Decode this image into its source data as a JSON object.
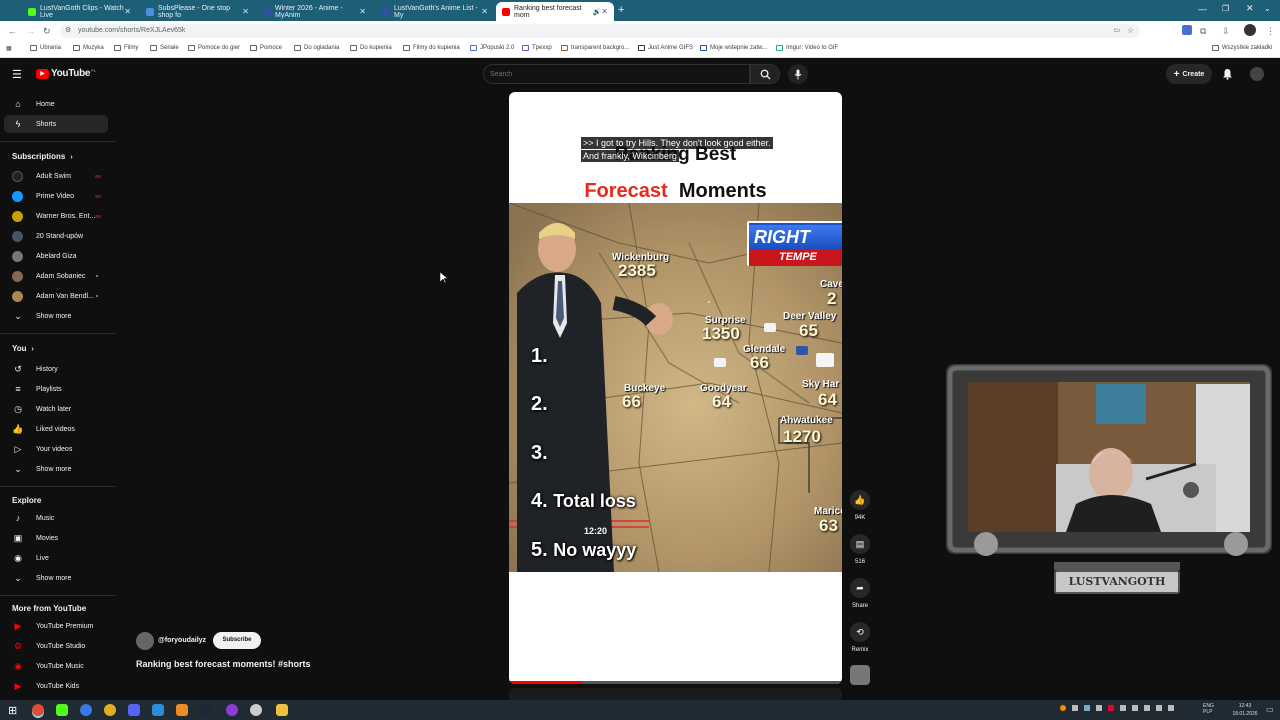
{
  "browser": {
    "tabs": [
      {
        "title": "LustVanGoth Clips - Watch Live",
        "color": "#53fc18"
      },
      {
        "title": "SubsPlease - One stop shop fo",
        "color": "#4a8fe0"
      },
      {
        "title": "Winter 2026 - Anime - MyAnim",
        "color": "#2e51a2"
      },
      {
        "title": "LustVanGoth's Anime List - My",
        "color": "#2e51a2"
      },
      {
        "title": "Ranking best forecast mom",
        "color": "#ff0000"
      }
    ],
    "new_tab": "+",
    "url": "youtube.com/shorts/ReXJLAev65k",
    "bookmarks": [
      "Ubrania",
      "Muzyka",
      "Filmy",
      "Seriale",
      "Pomoce do gier",
      "Pomoce",
      "Do ogladania",
      "Do kupienia",
      "Filmy do kupienia",
      "JPopuski 2.0",
      "Tpexxp",
      "transparent backgro...",
      "Just Anime GIFS",
      "Moje wstepnie zatw...",
      "Imgur: Video to GIF"
    ],
    "all_bookmarks": "Wszystkie zakładki"
  },
  "youtube": {
    "logo_text": "YouTube",
    "logo_country": "PL",
    "search_placeholder": "Search",
    "create_label": "Create",
    "nav": [
      {
        "label": "Home",
        "icon": "home-icon"
      },
      {
        "label": "Shorts",
        "icon": "shorts-icon"
      }
    ],
    "subscriptions_heading": "Subscriptions",
    "subscriptions": [
      {
        "name": "Adult Swim",
        "color": "#222222",
        "live": true
      },
      {
        "name": "Prime Video",
        "color": "#1a98ff",
        "live": true
      },
      {
        "name": "Warner Bros. Ent...",
        "color": "#c8a000",
        "live": true
      },
      {
        "name": "20 Stand-upów",
        "color": "#445566",
        "live": false
      },
      {
        "name": "Abelard Giza",
        "color": "#777777",
        "live": false
      },
      {
        "name": "Adam Sobaniec",
        "color": "#886655",
        "live": false
      },
      {
        "name": "Adam Van Bendl...",
        "color": "#aa8855",
        "live": false
      }
    ],
    "show_more": "Show more",
    "you_heading": "You",
    "you_items": [
      {
        "label": "History",
        "icon": "history-icon"
      },
      {
        "label": "Playlists",
        "icon": "playlists-icon"
      },
      {
        "label": "Watch later",
        "icon": "watch-later-icon"
      },
      {
        "label": "Liked videos",
        "icon": "liked-videos-icon"
      },
      {
        "label": "Your videos",
        "icon": "your-videos-icon"
      }
    ],
    "explore_heading": "Explore",
    "explore_items": [
      {
        "label": "Music",
        "icon": "music-icon"
      },
      {
        "label": "Movies",
        "icon": "movies-icon"
      },
      {
        "label": "Live",
        "icon": "live-icon"
      }
    ],
    "more_heading": "More from YouTube",
    "more_items": [
      "YouTube Premium",
      "YouTube Studio",
      "YouTube Music",
      "YouTube Kids"
    ],
    "short": {
      "caption": ">> I got to try Hills. They don't look good either. And frankly, Wikcinberg",
      "title_line1": "Ranking Best",
      "title_red": "Forecast",
      "title_black": "Moments",
      "ranks": [
        "1.",
        "2.",
        "3.",
        "4.",
        "5."
      ],
      "rank4_text": "Total loss",
      "rank5_text": "No wayyy",
      "banner_text": "RIGHT",
      "banner_sub": "TEMPE",
      "clock": "12:20",
      "map": [
        {
          "city": "Wickenburg",
          "temp": "2385"
        },
        {
          "city": "Surprise",
          "temp": "1350"
        },
        {
          "city": "Deer Valley",
          "temp": "65"
        },
        {
          "city": "Glendale",
          "temp": "66"
        },
        {
          "city": "Buckeye",
          "temp": "66"
        },
        {
          "city": "Goodyear",
          "temp": "64"
        },
        {
          "city": "Sky Har",
          "temp": "64"
        },
        {
          "city": "Ahwatukee",
          "temp": "1270"
        },
        {
          "city": "Cave",
          "temp": "2"
        },
        {
          "city": "Marico",
          "temp": "63"
        }
      ],
      "channel": "@foryoudailyz",
      "subscribe": "Subscribe",
      "video_title": "Ranking best forecast moments! #shorts",
      "progress": 0.22
    },
    "actions": [
      {
        "icon": "like-icon",
        "label": "94K"
      },
      {
        "icon": "comment-icon",
        "label": "516"
      },
      {
        "icon": "share-icon",
        "label": "Share"
      },
      {
        "icon": "remix-icon",
        "label": "Remix"
      }
    ]
  },
  "webcam": {
    "nameplate": "LUSTVANGOTH"
  },
  "taskbar": {
    "lang": "ENG\nPLP",
    "time": "12:43",
    "date": "18.01.2026"
  }
}
